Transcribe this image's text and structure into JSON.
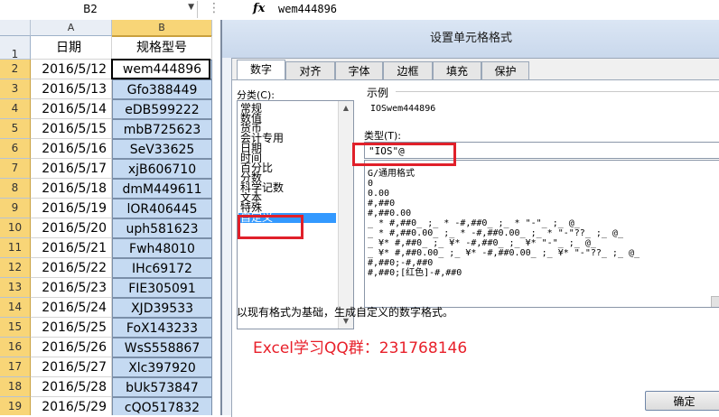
{
  "formula_bar": {
    "name_box": "B2",
    "fx_label": "fx",
    "formula": "wem444896"
  },
  "sheet": {
    "col_headers": [
      "A",
      "B"
    ],
    "header_row": {
      "row": "1",
      "a": "日期",
      "b": "规格型号"
    },
    "rows": [
      {
        "row": "2",
        "a": "2016/5/12",
        "b": "wem444896"
      },
      {
        "row": "3",
        "a": "2016/5/13",
        "b": "Gfo388449"
      },
      {
        "row": "4",
        "a": "2016/5/14",
        "b": "eDB599222"
      },
      {
        "row": "5",
        "a": "2016/5/15",
        "b": "mbB725623"
      },
      {
        "row": "6",
        "a": "2016/5/16",
        "b": "SeV33625"
      },
      {
        "row": "7",
        "a": "2016/5/17",
        "b": "xjB606710"
      },
      {
        "row": "8",
        "a": "2016/5/18",
        "b": "dmM449611"
      },
      {
        "row": "9",
        "a": "2016/5/19",
        "b": "lOR406445"
      },
      {
        "row": "10",
        "a": "2016/5/20",
        "b": "uph581623"
      },
      {
        "row": "11",
        "a": "2016/5/21",
        "b": "Fwh48010"
      },
      {
        "row": "12",
        "a": "2016/5/22",
        "b": "IHc69172"
      },
      {
        "row": "13",
        "a": "2016/5/23",
        "b": "FIE305091"
      },
      {
        "row": "14",
        "a": "2016/5/24",
        "b": "XJD39533"
      },
      {
        "row": "15",
        "a": "2016/5/25",
        "b": "FoX143233"
      },
      {
        "row": "16",
        "a": "2016/5/26",
        "b": "WsS558867"
      },
      {
        "row": "17",
        "a": "2016/5/27",
        "b": "Xlc397920"
      },
      {
        "row": "18",
        "a": "2016/5/28",
        "b": "bUk573847"
      },
      {
        "row": "19",
        "a": "2016/5/29",
        "b": "cQO517832"
      }
    ]
  },
  "dialog": {
    "title": "设置单元格格式",
    "tabs": [
      "数字",
      "对齐",
      "字体",
      "边框",
      "填充",
      "保护"
    ],
    "category_label": "分类(C):",
    "categories": [
      "常规",
      "数值",
      "货币",
      "会计专用",
      "日期",
      "时间",
      "百分比",
      "分数",
      "科学记数",
      "文本",
      "特殊",
      "自定义"
    ],
    "selected_category": "自定义",
    "sample_label": "示例",
    "sample_value": "IOSwem444896",
    "type_label": "类型(T):",
    "type_value": "\"IOS\"@",
    "format_list": [
      "G/通用格式",
      "0",
      "0.00",
      "#,##0",
      "#,##0.00",
      "_ * #,##0_ ;_ * -#,##0_ ;_ * \"-\"_ ;_ @_",
      "_ * #,##0.00_ ;_ * -#,##0.00_ ;_ * \"-\"??_ ;_ @_",
      "_ ¥* #,##0_ ;_ ¥* -#,##0_ ;_ ¥* \"-\"_ ;_ @_",
      "_ ¥* #,##0.00_ ;_ ¥* -#,##0.00_ ;_ ¥* \"-\"??_ ;_ @_",
      "#,##0;-#,##0",
      "#,##0;[红色]-#,##0"
    ],
    "description": "以现有格式为基础，生成自定义的数字格式。",
    "ok_label": "确定"
  },
  "watermark": "Excel学习QQ群：231768146",
  "colors": {
    "highlight": "#e0202a",
    "selection": "#3399ff",
    "selected_cells": "#c5daf2",
    "selected_header": "#f8d577"
  }
}
